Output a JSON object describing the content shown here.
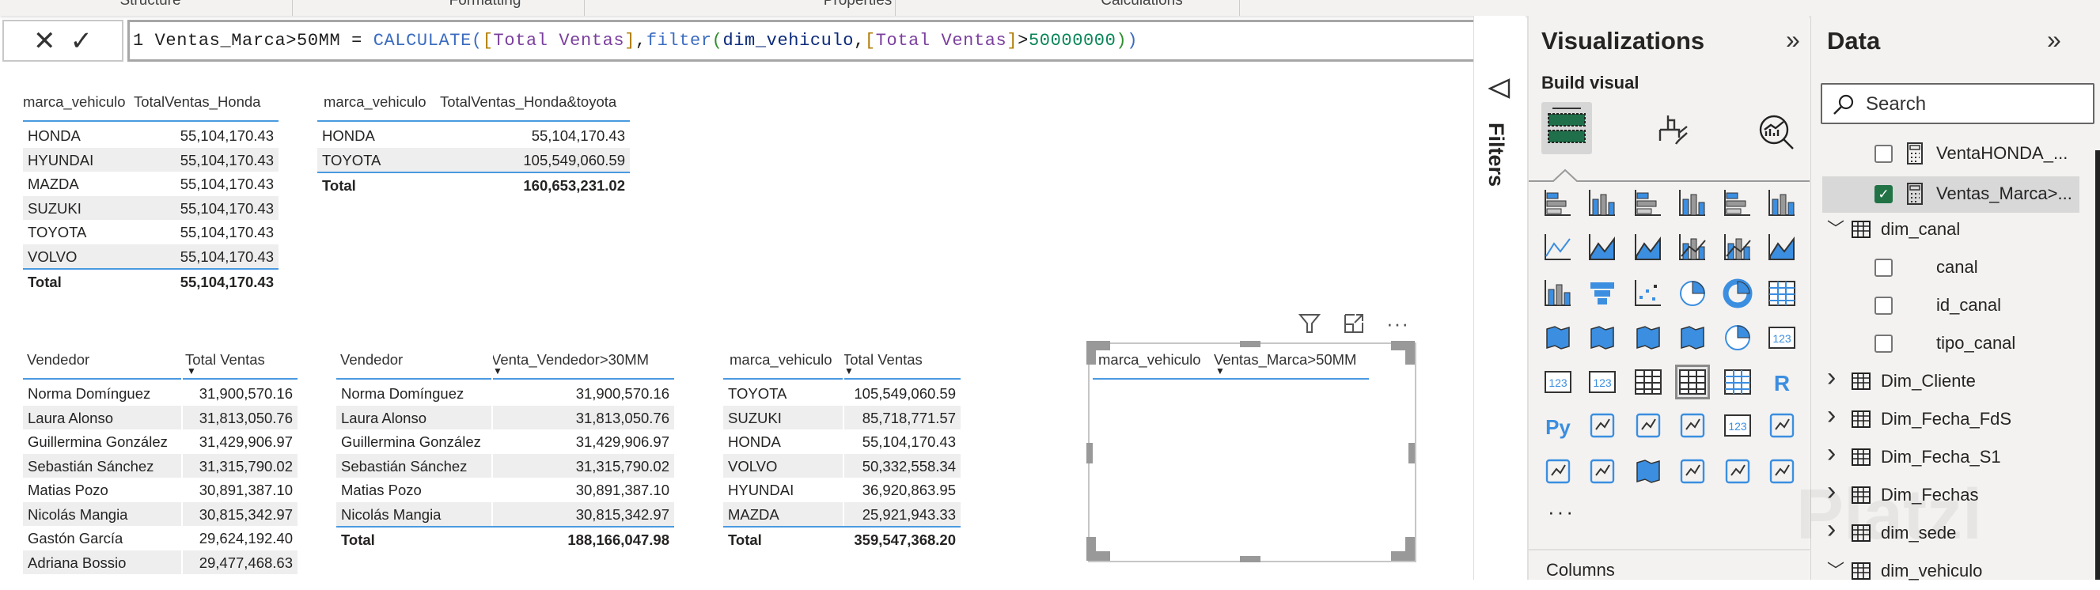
{
  "ribbon": {
    "tabs": [
      "Structure",
      "Formatting",
      "Properties",
      "Calculations"
    ]
  },
  "formula": {
    "cancel_icon": "✕",
    "commit_icon": "✓",
    "line_number": "1",
    "measure_name": "Ventas_Marca>50MM",
    "parts": [
      {
        "t": " = ",
        "c": ""
      },
      {
        "t": "CALCULATE",
        "c": "c-fn"
      },
      {
        "t": "(",
        "c": "c-pb"
      },
      {
        "t": "[",
        "c": "c-br"
      },
      {
        "t": "Total Ventas",
        "c": "c-ms"
      },
      {
        "t": "]",
        "c": "c-br"
      },
      {
        "t": ",",
        "c": ""
      },
      {
        "t": "filter",
        "c": "c-fn"
      },
      {
        "t": "(",
        "c": "c-pa"
      },
      {
        "t": "dim_vehiculo",
        "c": "c-tb"
      },
      {
        "t": ",",
        "c": ""
      },
      {
        "t": "[",
        "c": "c-br"
      },
      {
        "t": "Total Ventas",
        "c": "c-ms"
      },
      {
        "t": "]",
        "c": "c-br"
      },
      {
        "t": ">",
        "c": ""
      },
      {
        "t": "50000000",
        "c": "c-nm"
      },
      {
        "t": ")",
        "c": "c-pa"
      },
      {
        "t": ")",
        "c": "c-pb"
      }
    ],
    "expand_icon": "chevron-down-icon"
  },
  "tables": [
    {
      "id": "t1",
      "columns": [
        "marca_vehiculo",
        "TotalVentas_Honda"
      ],
      "rows": [
        [
          "HONDA",
          "55,104,170.43"
        ],
        [
          "HYUNDAI",
          "55,104,170.43"
        ],
        [
          "MAZDA",
          "55,104,170.43"
        ],
        [
          "SUZUKI",
          "55,104,170.43"
        ],
        [
          "TOYOTA",
          "55,104,170.43"
        ],
        [
          "VOLVO",
          "55,104,170.43"
        ]
      ],
      "total": [
        "Total",
        "55,104,170.43"
      ]
    },
    {
      "id": "t2",
      "columns": [
        "marca_vehiculo",
        "TotalVentas_Honda&toyota"
      ],
      "rows": [
        [
          "HONDA",
          "55,104,170.43"
        ],
        [
          "TOYOTA",
          "105,549,060.59"
        ]
      ],
      "total": [
        "Total",
        "160,653,231.02"
      ]
    },
    {
      "id": "t3",
      "columns": [
        "Vendedor",
        "Total Ventas"
      ],
      "sort_col": 1,
      "rows": [
        [
          "Norma Domínguez",
          "31,900,570.16"
        ],
        [
          "Laura Alonso",
          "31,813,050.76"
        ],
        [
          "Guillermina González",
          "31,429,906.97"
        ],
        [
          "Sebastián Sánchez",
          "31,315,790.02"
        ],
        [
          "Matias Pozo",
          "30,891,387.10"
        ],
        [
          "Nicolás Mangia",
          "30,815,342.97"
        ],
        [
          "Gastón García",
          "29,624,192.40"
        ],
        [
          "Adriana Bossio",
          "29,477,468.63"
        ]
      ]
    },
    {
      "id": "t4",
      "columns": [
        "Vendedor",
        "Venta_Vendedor>30MM"
      ],
      "sort_col": 1,
      "rows": [
        [
          "Norma Domínguez",
          "31,900,570.16"
        ],
        [
          "Laura Alonso",
          "31,813,050.76"
        ],
        [
          "Guillermina González",
          "31,429,906.97"
        ],
        [
          "Sebastián Sánchez",
          "31,315,790.02"
        ],
        [
          "Matias Pozo",
          "30,891,387.10"
        ],
        [
          "Nicolás Mangia",
          "30,815,342.97"
        ]
      ],
      "total": [
        "Total",
        "188,166,047.98"
      ]
    },
    {
      "id": "t5",
      "columns": [
        "marca_vehiculo",
        "Total Ventas"
      ],
      "sort_col": 1,
      "rows": [
        [
          "TOYOTA",
          "105,549,060.59"
        ],
        [
          "SUZUKI",
          "85,718,771.57"
        ],
        [
          "HONDA",
          "55,104,170.43"
        ],
        [
          "VOLVO",
          "50,332,558.34"
        ],
        [
          "HYUNDAI",
          "36,920,863.95"
        ],
        [
          "MAZDA",
          "25,921,943.33"
        ]
      ],
      "total": [
        "Total",
        "359,547,368.20"
      ]
    },
    {
      "id": "t6",
      "columns": [
        "marca_vehiculo",
        "Ventas_Marca>50MM"
      ],
      "sort_col": 1,
      "rows": []
    }
  ],
  "visual_header": {
    "filter_icon": "filter-icon",
    "focus_icon": "focus-mode-icon",
    "more_icon": "more-options-icon",
    "more": "···"
  },
  "filters": {
    "label": "Filters",
    "icon": "filter-icon"
  },
  "visualizations": {
    "title": "Visualizations",
    "collapse": "»",
    "build_visual": "Build visual",
    "tabs": [
      "build-visual",
      "format-visual",
      "analytics"
    ],
    "icons": [
      "stacked-bar-chart",
      "stacked-column-chart",
      "clustered-bar-chart",
      "clustered-column-chart",
      "100-stacked-bar-chart",
      "100-stacked-column-chart",
      "line-chart",
      "area-chart",
      "stacked-area-chart",
      "line-stacked-column-chart",
      "line-clustered-column-chart",
      "ribbon-chart",
      "waterfall-chart",
      "funnel",
      "scatter-chart",
      "pie-chart",
      "donut-chart",
      "treemap",
      "map",
      "filled-map",
      "shape-map",
      "azure-map",
      "gauge",
      "card",
      "multi-row-card",
      "kpi",
      "slicer",
      "table",
      "matrix",
      "r-visual",
      "python-visual",
      "key-influencers",
      "decomposition-tree",
      "qa",
      "smart-narrative",
      "metrics",
      "paginated-report",
      "power-apps",
      "arcgis-map",
      "power-apps-logo",
      "power-automate",
      "custom-visual"
    ],
    "selected_icon": "table",
    "more": "···",
    "columns_label": "Columns"
  },
  "data": {
    "title": "Data",
    "collapse": "»",
    "search_placeholder": "Search",
    "items": [
      {
        "label": "VentaHONDA_...",
        "type": "measure",
        "checked": false
      },
      {
        "label": "Ventas_Marca>...",
        "type": "measure",
        "checked": true,
        "selected": true
      },
      {
        "label": "dim_canal",
        "type": "table",
        "expanded": true
      },
      {
        "label": "canal",
        "type": "field",
        "checked": false
      },
      {
        "label": "id_canal",
        "type": "field",
        "checked": false
      },
      {
        "label": "tipo_canal",
        "type": "field",
        "checked": false
      },
      {
        "label": "Dim_Cliente",
        "type": "table",
        "expanded": false
      },
      {
        "label": "Dim_Fecha_FdS",
        "type": "calc-table",
        "expanded": false
      },
      {
        "label": "Dim_Fecha_S1",
        "type": "calc-table",
        "expanded": false
      },
      {
        "label": "Dim_Fechas",
        "type": "calc-table",
        "expanded": false
      },
      {
        "label": "dim_sede",
        "type": "table",
        "expanded": false
      },
      {
        "label": "dim_vehiculo",
        "type": "table",
        "expanded": true
      }
    ]
  },
  "watermark": "Platzi",
  "colors": {
    "accent": "#4a9ae0",
    "checkbox": "#217346",
    "viz_blue": "#3b8ee0"
  }
}
